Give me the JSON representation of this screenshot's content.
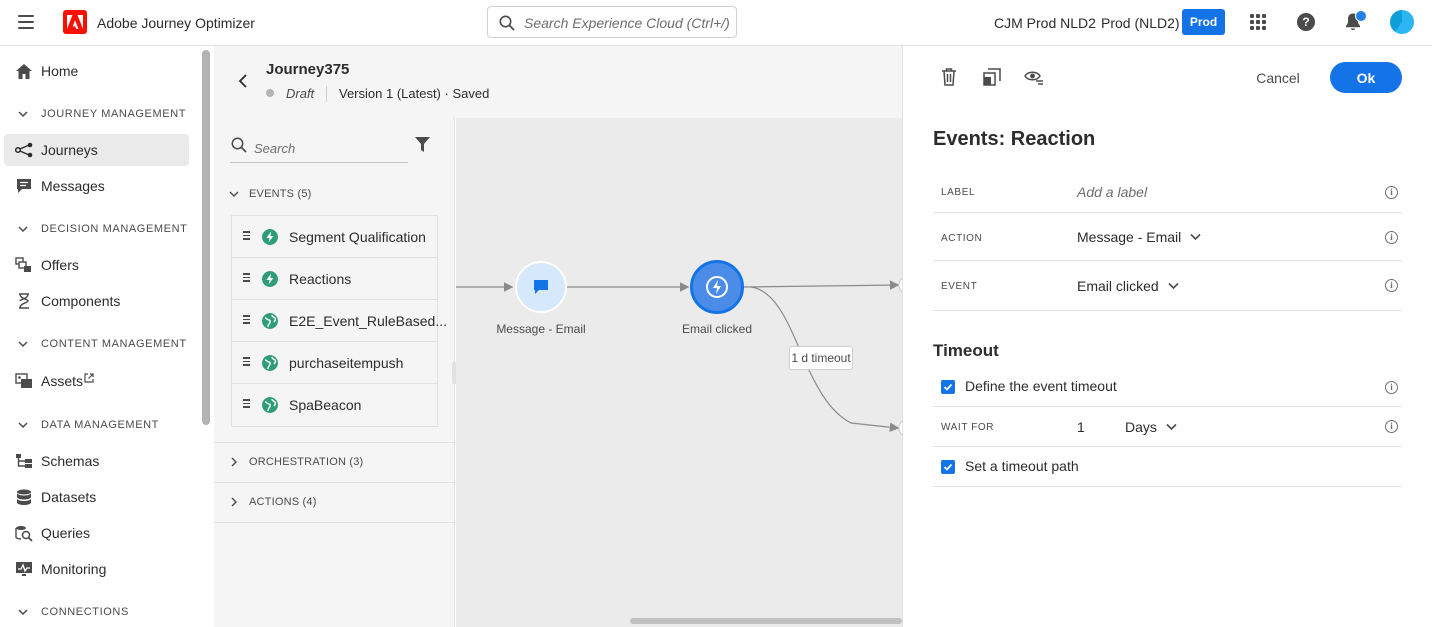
{
  "topbar": {
    "app_title": "Adobe Journey Optimizer",
    "search_placeholder": "Search Experience Cloud (Ctrl+/)",
    "org": "CJM Prod NLD2",
    "sandbox": "Prod (NLD2)",
    "env_badge": "Prod",
    "help": "?"
  },
  "leftnav": {
    "home": "Home",
    "sections": {
      "journey_management": "JOURNEY MANAGEMENT",
      "decision_management": "DECISION MANAGEMENT",
      "content_management": "CONTENT MANAGEMENT",
      "data_management": "DATA MANAGEMENT",
      "connections": "CONNECTIONS"
    },
    "items": {
      "journeys": "Journeys",
      "messages": "Messages",
      "offers": "Offers",
      "components": "Components",
      "assets": "Assets",
      "schemas": "Schemas",
      "datasets": "Datasets",
      "queries": "Queries",
      "monitoring": "Monitoring"
    }
  },
  "journey": {
    "name": "Journey375",
    "status": "Draft",
    "version": "Version 1 (Latest) · Saved"
  },
  "palette": {
    "search_placeholder": "Search",
    "events_header": "EVENTS (5)",
    "events": [
      "Segment Qualification",
      "Reactions",
      "E2E_Event_RuleBased...",
      "purchaseitempush",
      "SpaBeacon"
    ],
    "orchestration_header": "ORCHESTRATION (3)",
    "actions_header": "ACTIONS (4)"
  },
  "canvas": {
    "node1_label": "Message - Email",
    "node2_label": "Email clicked",
    "timeout_tag": "1 d timeout"
  },
  "panel": {
    "cancel": "Cancel",
    "ok": "Ok",
    "title": "Events: Reaction",
    "label_key": "LABEL",
    "label_placeholder": "Add a label",
    "action_key": "ACTION",
    "action_value": "Message - Email",
    "event_key": "EVENT",
    "event_value": "Email clicked",
    "timeout_title": "Timeout",
    "define_timeout": "Define the event timeout",
    "wait_for_key": "WAIT FOR",
    "wait_for_value": "1",
    "wait_for_unit": "Days",
    "timeout_path": "Set a timeout path",
    "info": "i"
  },
  "colors": {
    "accent": "#1473e6",
    "adobe_red": "#fa0f00",
    "event_green": "#2d9d78"
  }
}
